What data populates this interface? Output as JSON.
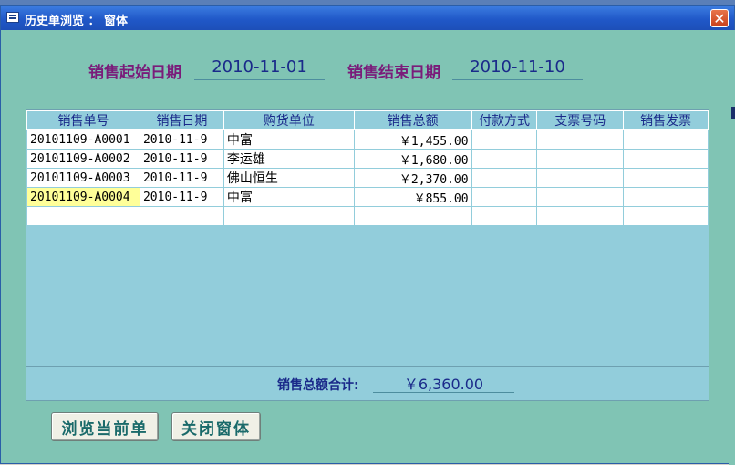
{
  "window": {
    "title": "历史单浏览 ： 窗体",
    "close_glyph": "✕"
  },
  "filters": {
    "start_label": "销售起始日期",
    "start_value": "2010-11-01",
    "end_label": "销售结束日期",
    "end_value": "2010-11-10"
  },
  "grid": {
    "columns": [
      "销售单号",
      "销售日期",
      "购货单位",
      "销售总额",
      "付款方式",
      "支票号码",
      "销售发票"
    ],
    "rows": [
      [
        "20101109-A0001",
        "2010-11-9",
        "中富",
        "￥1,455.00",
        "",
        "",
        ""
      ],
      [
        "20101109-A0002",
        "2010-11-9",
        "李运雄",
        "￥1,680.00",
        "",
        "",
        ""
      ],
      [
        "20101109-A0003",
        "2010-11-9",
        "佛山恒生",
        "￥2,370.00",
        "",
        "",
        ""
      ],
      [
        "20101109-A0004",
        "2010-11-9",
        "中富",
        "￥855.00",
        "",
        "",
        ""
      ]
    ]
  },
  "summary": {
    "label": "销售总额合计:",
    "value": "￥6,360.00"
  },
  "buttons": {
    "browse": "浏览当前单",
    "close": "关闭窗体"
  },
  "colors": {
    "form_bg": "#80c4b4",
    "grid_bg": "#92cddb",
    "label_purple": "#7a1c7a",
    "value_blue": "#1a2a8a",
    "titlebar": "#2058c8"
  }
}
